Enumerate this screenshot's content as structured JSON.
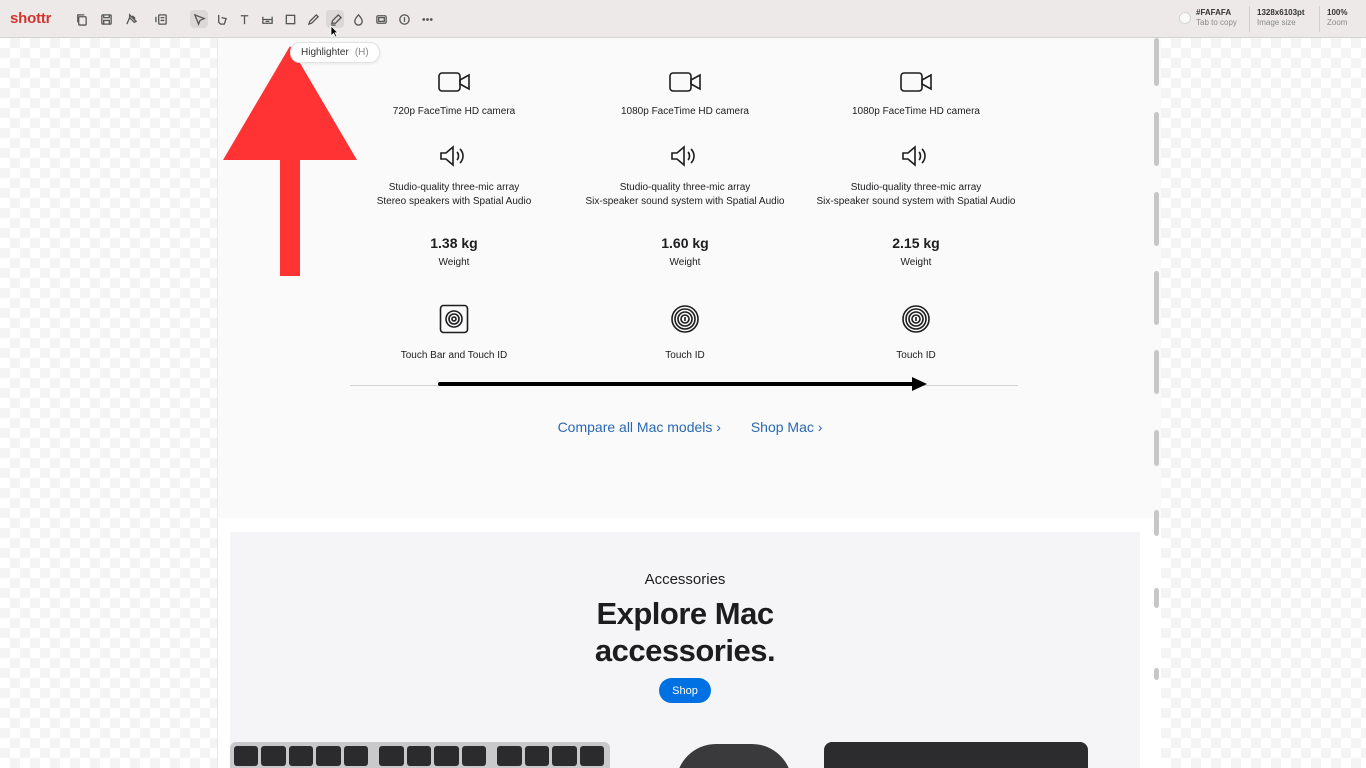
{
  "app": {
    "name": "shottr",
    "brand_color": "#d0362f"
  },
  "toolbar": {
    "tools": [
      {
        "name": "copy",
        "icon": "copy-icon"
      },
      {
        "name": "save",
        "icon": "save-icon"
      },
      {
        "name": "pin",
        "icon": "pin-icon"
      },
      {
        "name": "ocr",
        "icon": "text-recognize-icon"
      },
      {
        "name": "select",
        "icon": "arrow-select-icon"
      },
      {
        "name": "erase",
        "icon": "eraser-icon"
      },
      {
        "name": "text",
        "icon": "text-tool-icon"
      },
      {
        "name": "ruler",
        "icon": "ruler-icon"
      },
      {
        "name": "rectangle",
        "icon": "rectangle-icon"
      },
      {
        "name": "pencil",
        "icon": "pencil-icon"
      },
      {
        "name": "highlighter",
        "icon": "highlighter-icon"
      },
      {
        "name": "blur",
        "icon": "drop-icon"
      },
      {
        "name": "spotlight",
        "icon": "spotlight-icon"
      },
      {
        "name": "step",
        "icon": "step-counter-icon"
      },
      {
        "name": "more",
        "icon": "more-icon"
      }
    ],
    "color_value": "#FAFAFA",
    "color_hint": "Tab to copy",
    "image_size_value": "1328x6103pt",
    "image_size_label": "Image size",
    "zoom_value": "100%",
    "zoom_label": "Zoom"
  },
  "tooltip": {
    "label": "Highlighter",
    "shortcut": "(H)"
  },
  "compare": {
    "cameras": [
      "720p FaceTime HD camera",
      "1080p FaceTime HD camera",
      "1080p FaceTime HD camera"
    ],
    "audio": [
      {
        "line1": "Studio-quality three-mic array",
        "line2": "Stereo speakers with Spatial Audio"
      },
      {
        "line1": "Studio-quality three-mic array",
        "line2": "Six-speaker sound system with Spatial Audio"
      },
      {
        "line1": "Studio-quality three-mic array",
        "line2": "Six-speaker sound system with Spatial Audio"
      }
    ],
    "weights": [
      {
        "value": "1.38 kg",
        "label": "Weight"
      },
      {
        "value": "1.60 kg",
        "label": "Weight"
      },
      {
        "value": "2.15 kg",
        "label": "Weight"
      }
    ],
    "touch": [
      "Touch Bar and Touch ID",
      "Touch ID",
      "Touch ID"
    ]
  },
  "links": {
    "compare_all": "Compare all Mac models ›",
    "shop_mac": "Shop Mac ›",
    "link_color": "#2a68b3"
  },
  "accessories": {
    "eyebrow": "Accessories",
    "title_line1": "Explore Mac",
    "title_line2": "accessories.",
    "shop_button": "Shop",
    "button_color": "#0071e3"
  },
  "annotations": {
    "arrow_color": "#ff3333",
    "line_arrow_color": "#000000"
  }
}
